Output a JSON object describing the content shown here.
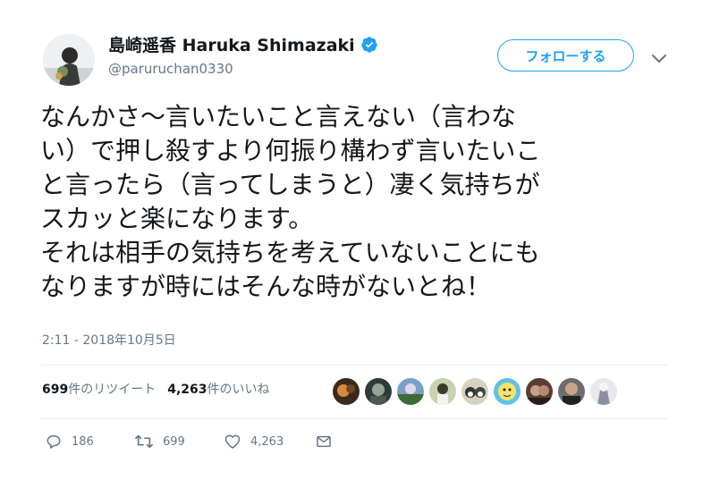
{
  "user": {
    "display_name": "島崎遥香 Haruka Shimazaki",
    "handle": "@paruruchan0330"
  },
  "follow_button": {
    "label": "フォローする"
  },
  "tweet": {
    "lines": [
      "なんかさ〜言いたいこと言えない（言わな",
      "い）で押し殺すより何振り構わず言いたいこ",
      "と言ったら（言ってしまうと）凄く気持ちが",
      "スカッと楽になります。",
      "それは相手の気持ちを考えていないことにも",
      "なりますが時にはそんな時がないとね！"
    ],
    "timestamp": "2:11 - 2018年10月5日"
  },
  "stats": {
    "retweets_count": "699",
    "retweets_label": "件のリツイート",
    "likes_count": "4,263",
    "likes_label": "件のいいね"
  },
  "actions": {
    "reply_count": "186",
    "retweet_count": "699",
    "like_count": "4,263"
  },
  "colors": {
    "accent": "#1da1f2",
    "secondary_text": "#657786",
    "divider": "#e6ecf0"
  }
}
